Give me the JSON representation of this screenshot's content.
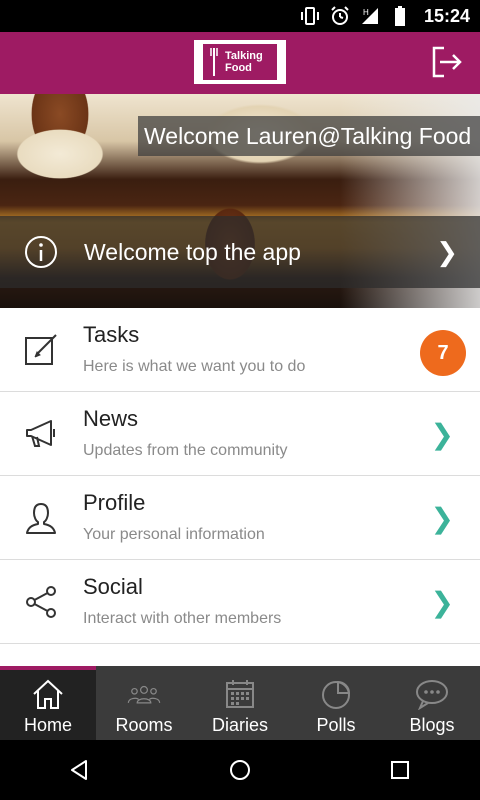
{
  "status_bar": {
    "time": "15:24",
    "icons": [
      "vibrate-icon",
      "alarm-icon",
      "signal-h-icon",
      "battery-icon"
    ]
  },
  "app_bar": {
    "logo_text": "Talking\nFood",
    "logout_icon": "logout-icon"
  },
  "hero": {
    "welcome_user": "Welcome Lauren@Talking Food",
    "banner_label": "Welcome top the app",
    "banner_icon": "info-icon",
    "banner_chevron": "❯"
  },
  "menu": {
    "items": [
      {
        "title": "Tasks",
        "subtitle": "Here is what we want you to do",
        "icon": "edit-icon",
        "badge": "7"
      },
      {
        "title": "News",
        "subtitle": "Updates from the community",
        "icon": "megaphone-icon",
        "chevron": "❯"
      },
      {
        "title": "Profile",
        "subtitle": "Your personal information",
        "icon": "user-icon",
        "chevron": "❯"
      },
      {
        "title": "Social",
        "subtitle": "Interact with other members",
        "icon": "share-icon",
        "chevron": "❯"
      }
    ]
  },
  "tabs": [
    {
      "label": "Home",
      "icon": "home-icon",
      "active": true
    },
    {
      "label": "Rooms",
      "icon": "group-icon",
      "active": false
    },
    {
      "label": "Diaries",
      "icon": "calendar-icon",
      "active": false
    },
    {
      "label": "Polls",
      "icon": "pie-chart-icon",
      "active": false
    },
    {
      "label": "Blogs",
      "icon": "chat-bubble-icon",
      "active": false
    }
  ],
  "colors": {
    "brand": "#9e1b63",
    "accent_chevron": "#3cb39a",
    "badge": "#ee6a1d",
    "tab_bar": "#3b3b3b"
  }
}
